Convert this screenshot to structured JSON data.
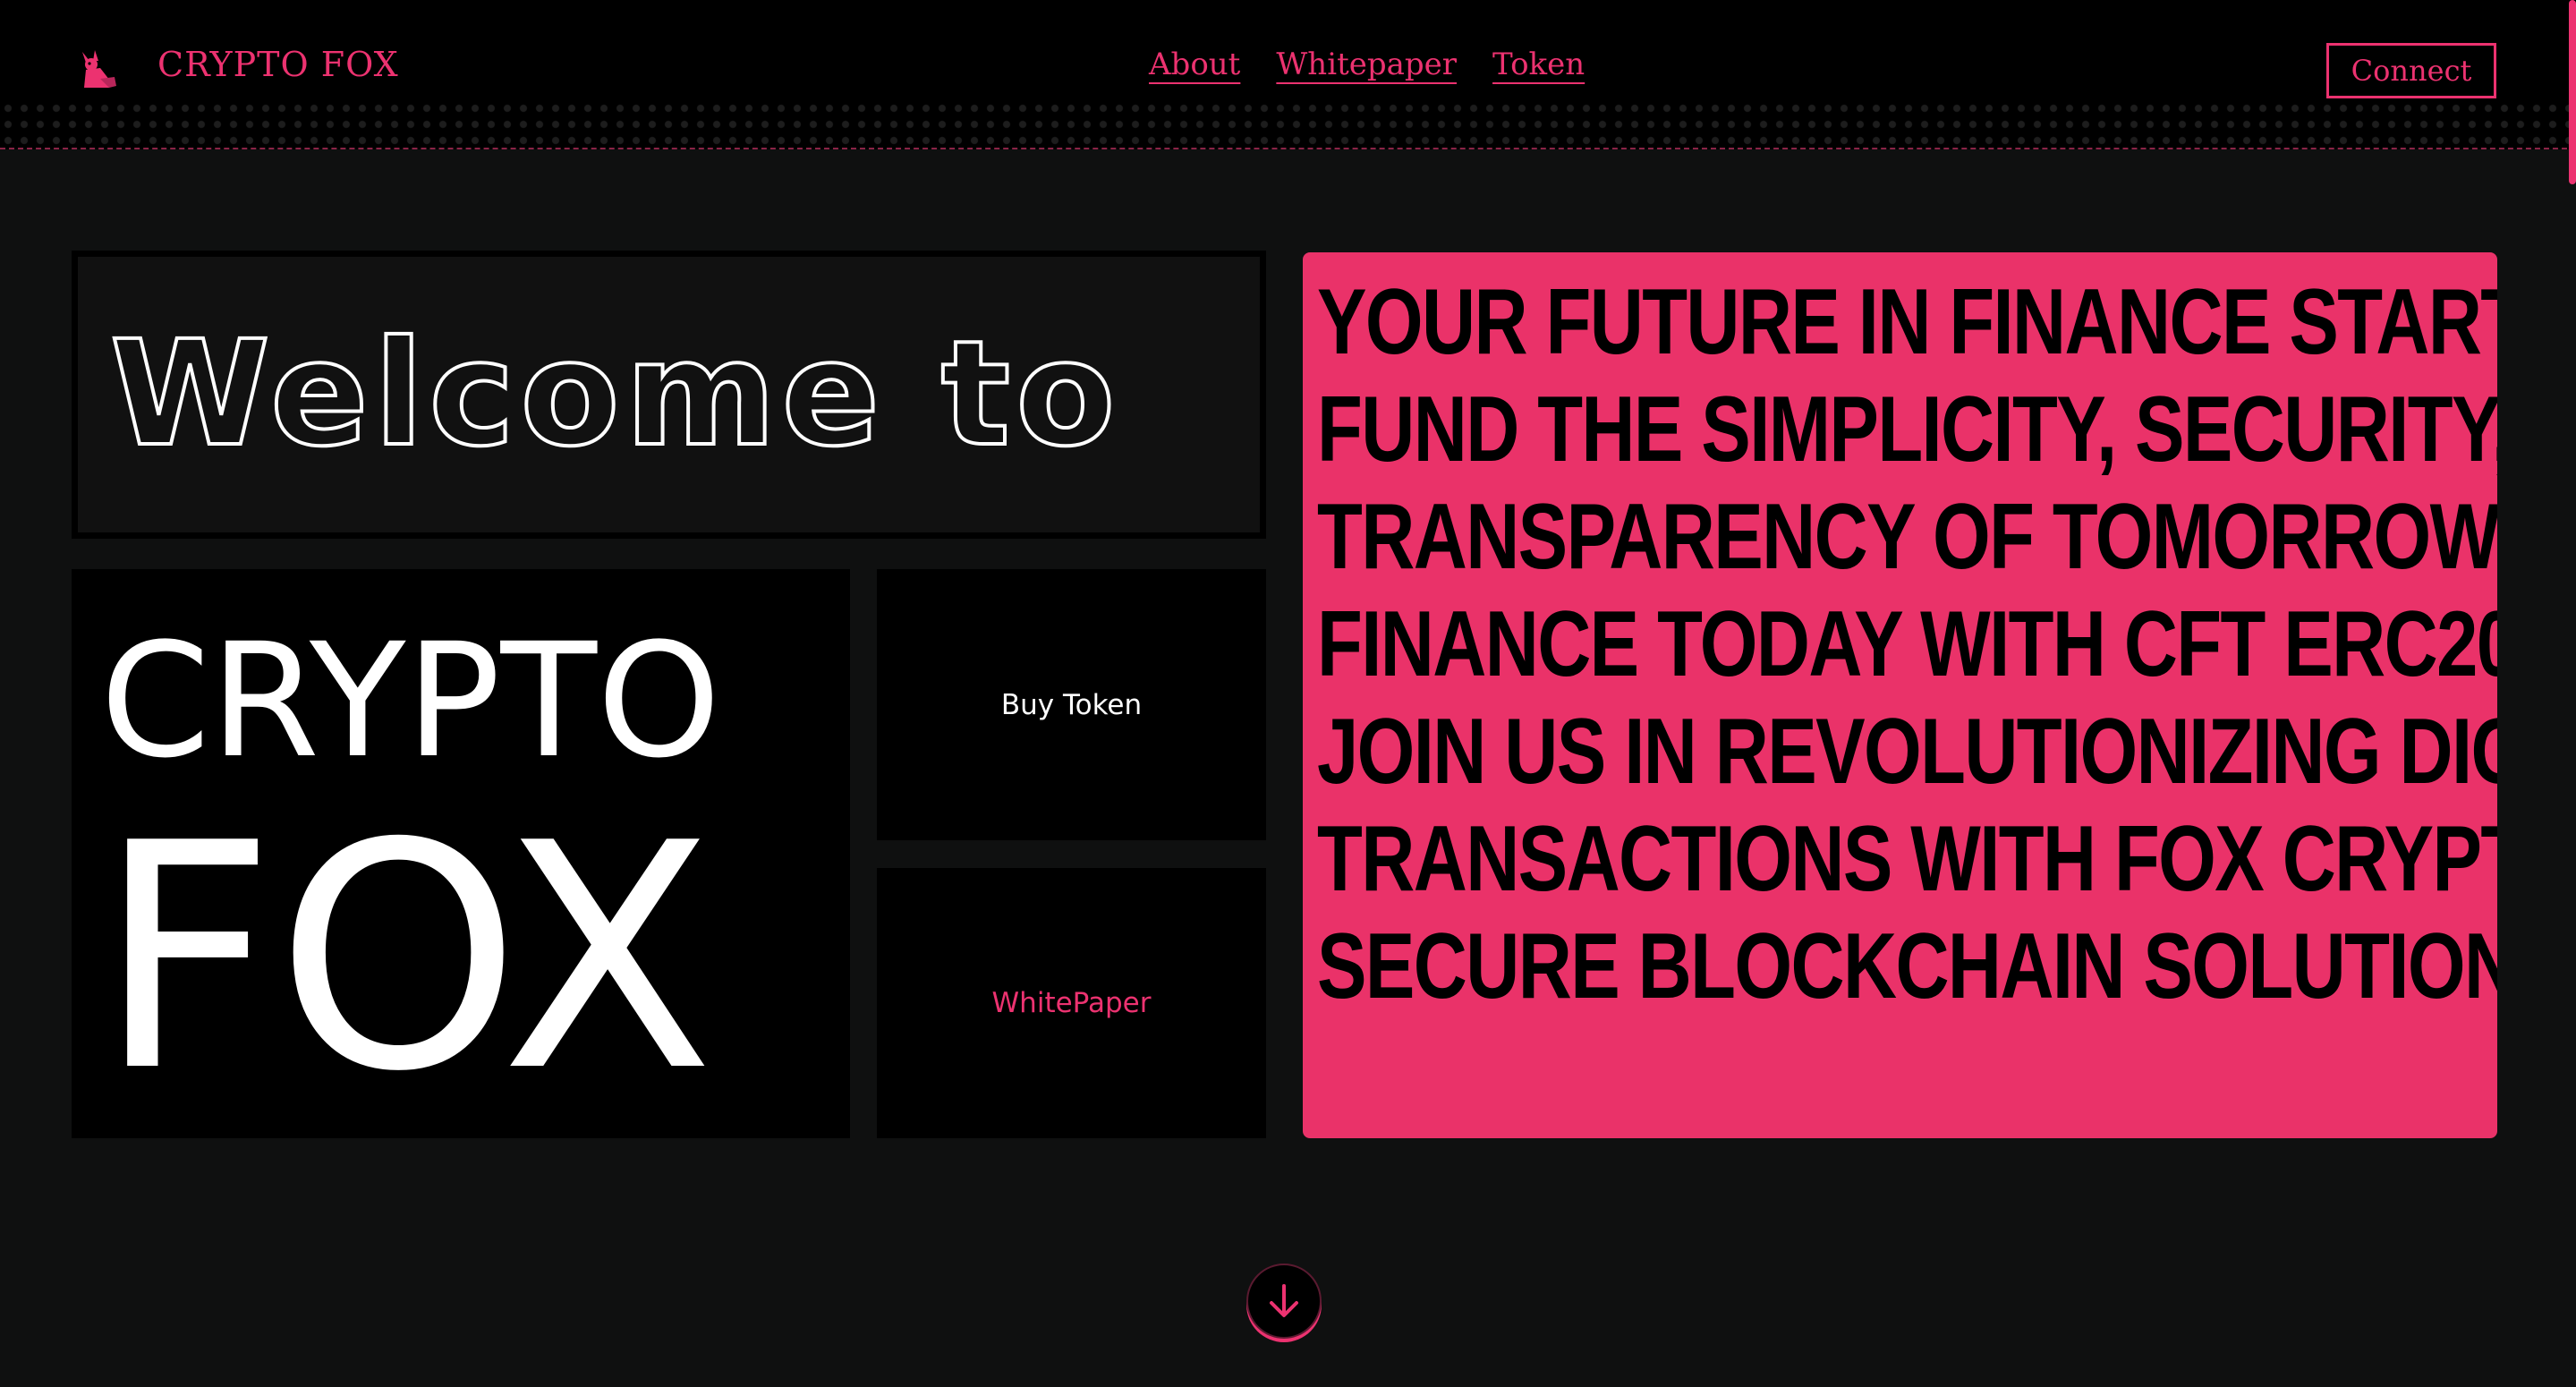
{
  "header": {
    "brand": "CRYPTO FOX",
    "nav": {
      "about": "About",
      "whitepaper": "Whitepaper",
      "token": "Token"
    },
    "connect_label": "Connect"
  },
  "main": {
    "welcome": "Welcome to",
    "name_line1": "CRYPTO",
    "name_line2": "FOX",
    "buy_token_label": "Buy Token",
    "whitepaper_label": "WhitePaper",
    "hero_text": "Your future in finance starts here! Fund the simplicity, security, and transparency of tomorrow's finance today with CFT ERC20 token. Join us in revolutionizing digital transactions with Fox Crypto's secure blockchain solution."
  },
  "icons": {
    "logo": "fox-logo-icon",
    "scroll": "arrow-down-icon"
  },
  "colors": {
    "accent": "#ec3270",
    "panel": "#ea3269",
    "background": "#0f1010",
    "tile": "#000000"
  }
}
